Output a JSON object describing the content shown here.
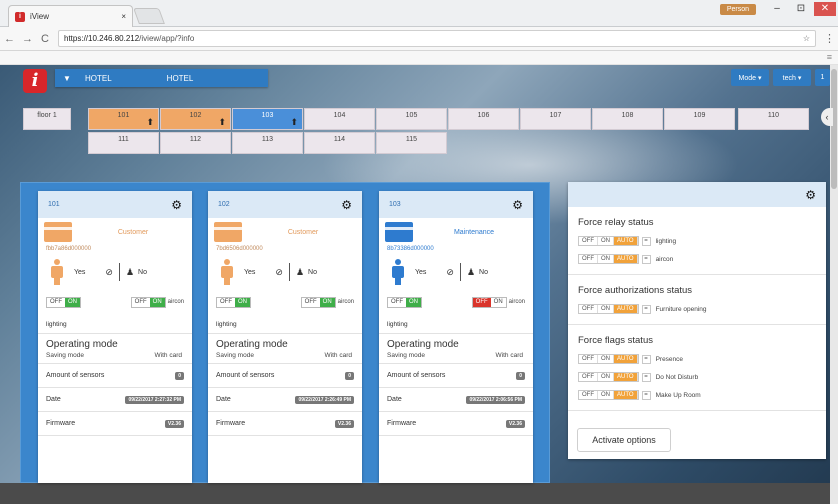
{
  "browser": {
    "tab_title": "iView",
    "tab_close": "×",
    "favicon": "i",
    "user": "Person",
    "url_host": "https://10.246.80.212",
    "url_path": "/iview/app/?info",
    "back": "←",
    "forward": "→",
    "reload": "C",
    "menu": "⋮",
    "star": "☆",
    "win_min": "–",
    "win_max": "⊡",
    "win_close": "✕",
    "bookmarks_dots": "≡"
  },
  "app": {
    "logo": "i",
    "hotel_label_1": "HOTEL",
    "hotel_label_2": "HOTEL",
    "filter_icon": "▼",
    "mode_btn": "Mode ▾",
    "tech_btn": "tech ▾",
    "count_btn": "1",
    "side_toggle": "‹"
  },
  "rooms": {
    "floor": "floor 1",
    "row1": [
      "101",
      "102",
      "103",
      "104",
      "105",
      "106",
      "107",
      "108",
      "109",
      "110"
    ],
    "row2": [
      "111",
      "112",
      "113",
      "114",
      "115"
    ]
  },
  "cards": [
    {
      "room": "101",
      "status": "Customer",
      "serial": "fbb7a86d000000",
      "presence": "Yes",
      "maid": "No",
      "light_off": "OFF",
      "light_on": "ON",
      "ac_off": "OFF",
      "ac_on": "ON",
      "ac_label": "aircon",
      "lighting": "lighting",
      "op_title": "Operating mode",
      "saving": "Saving mode",
      "with_card": "With card",
      "sensors_label": "Amount of sensors",
      "sensors": "0",
      "date_label": "Date",
      "date": "09/22/2017 2:27:32 PM",
      "fw_label": "Firmware",
      "fw": "V2.36"
    },
    {
      "room": "102",
      "status": "Customer",
      "serial": "7bd6506d000000",
      "presence": "Yes",
      "maid": "No",
      "light_off": "OFF",
      "light_on": "ON",
      "ac_off": "OFF",
      "ac_on": "ON",
      "ac_label": "aircon",
      "lighting": "lighting",
      "op_title": "Operating mode",
      "saving": "Saving mode",
      "with_card": "With card",
      "sensors_label": "Amount of sensors",
      "sensors": "0",
      "date_label": "Date",
      "date": "09/22/2017 2:26:49 PM",
      "fw_label": "Firmware",
      "fw": "V2.36"
    },
    {
      "room": "103",
      "status": "Maintenance",
      "serial": "8b73386d000000",
      "presence": "Yes",
      "maid": "No",
      "light_off": "OFF",
      "light_on": "ON",
      "ac_off": "OFF",
      "ac_on": "ON",
      "ac_label": "aircon",
      "lighting": "lighting",
      "op_title": "Operating mode",
      "saving": "Saving mode",
      "with_card": "With card",
      "sensors_label": "Amount of sensors",
      "sensors": "0",
      "date_label": "Date",
      "date": "09/22/2017 2:06:56 PM",
      "fw_label": "Firmware",
      "fw": "V2.36"
    }
  ],
  "panel": {
    "relay_title": "Force relay status",
    "relay_rows": [
      "lighting",
      "aircon"
    ],
    "auth_title": "Force authorizations status",
    "auth_rows": [
      "Furniture opening"
    ],
    "flags_title": "Force flags status",
    "flag_rows": [
      "Presence",
      "Do Not Disturb",
      "Make Up Room"
    ],
    "off": "OFF",
    "on": "ON",
    "auto": "AUTO",
    "eq": "=",
    "activate": "Activate options"
  },
  "colors": {
    "accent": "#2f7bc2",
    "occupied": "#f0a766",
    "maintenance": "#2e7bcf",
    "on": "#3fae49",
    "alert": "#d9342b",
    "auto": "#f1a23a"
  }
}
